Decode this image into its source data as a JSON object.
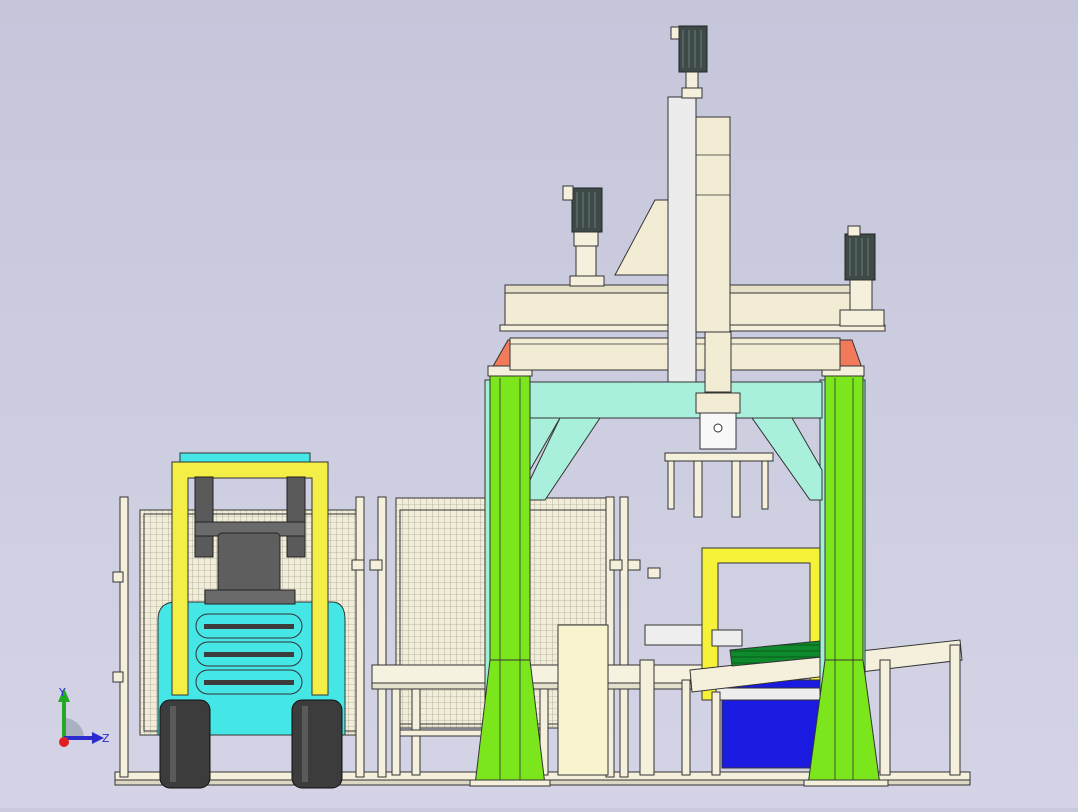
{
  "viewport": {
    "background_top": "#c6c6db",
    "background_bottom": "#d4d4e6"
  },
  "colors": {
    "gantry_column": "#7be61c",
    "column_frame": "#9ff0d4",
    "cross_brace": "#a8f0dc",
    "beam": "#f2ecd4",
    "cone": "#f07a5a",
    "forklift_body": "#44e6e6",
    "forklift_mast": "#f3ef46",
    "motor": "#3e4a48",
    "wheel": "#3c3c3c",
    "fence_mesh": "#f1edd8",
    "pallet_tray": "#1a1ae0",
    "conveyor_belt": "#0e8a2c",
    "yellow_frame": "#f6f23a"
  },
  "triad": {
    "y_label": "Y",
    "z_label": "Z",
    "x_axis_color": "#e02020",
    "y_axis_color": "#22aa22",
    "z_axis_color": "#2b2bd0"
  }
}
